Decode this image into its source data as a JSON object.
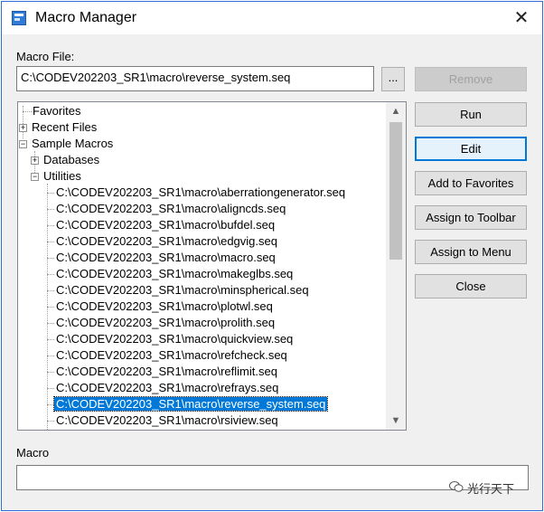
{
  "window": {
    "title": "Macro Manager",
    "close_glyph": "✕",
    "app_icon": "app-icon"
  },
  "macro_file": {
    "label": "Macro File:",
    "value": "C:\\CODEV202203_SR1\\macro\\reverse_system.seq",
    "browse_label": "..."
  },
  "buttons": {
    "remove": "Remove",
    "run": "Run",
    "edit": "Edit",
    "add_to_favorites": "Add to Favorites",
    "assign_to_toolbar": "Assign to Toolbar",
    "assign_to_menu": "Assign to Menu",
    "close": "Close"
  },
  "tree": {
    "favorites": "Favorites",
    "recent_files": "Recent Files",
    "sample_macros": "Sample Macros",
    "databases": "Databases",
    "utilities": "Utilities",
    "files": [
      "C:\\CODEV202203_SR1\\macro\\aberrationgenerator.seq",
      "C:\\CODEV202203_SR1\\macro\\aligncds.seq",
      "C:\\CODEV202203_SR1\\macro\\bufdel.seq",
      "C:\\CODEV202203_SR1\\macro\\edgvig.seq",
      "C:\\CODEV202203_SR1\\macro\\macro.seq",
      "C:\\CODEV202203_SR1\\macro\\makeglbs.seq",
      "C:\\CODEV202203_SR1\\macro\\minspherical.seq",
      "C:\\CODEV202203_SR1\\macro\\plotwl.seq",
      "C:\\CODEV202203_SR1\\macro\\prolith.seq",
      "C:\\CODEV202203_SR1\\macro\\quickview.seq",
      "C:\\CODEV202203_SR1\\macro\\refcheck.seq",
      "C:\\CODEV202203_SR1\\macro\\reflimit.seq",
      "C:\\CODEV202203_SR1\\macro\\refrays.seq",
      "C:\\CODEV202203_SR1\\macro\\reverse_system.seq",
      "C:\\CODEV202203_SR1\\macro\\rsiview.seq"
    ],
    "selected_file": "C:\\CODEV202203_SR1\\macro\\reverse_system.seq",
    "expand_glyph": "+",
    "collapse_glyph": "−"
  },
  "scrollbar": {
    "up_glyph": "▲",
    "down_glyph": "▼"
  },
  "macro": {
    "label": "Macro",
    "value": ""
  },
  "watermark": {
    "text": "光行天下",
    "icon": "wechat-icon"
  }
}
